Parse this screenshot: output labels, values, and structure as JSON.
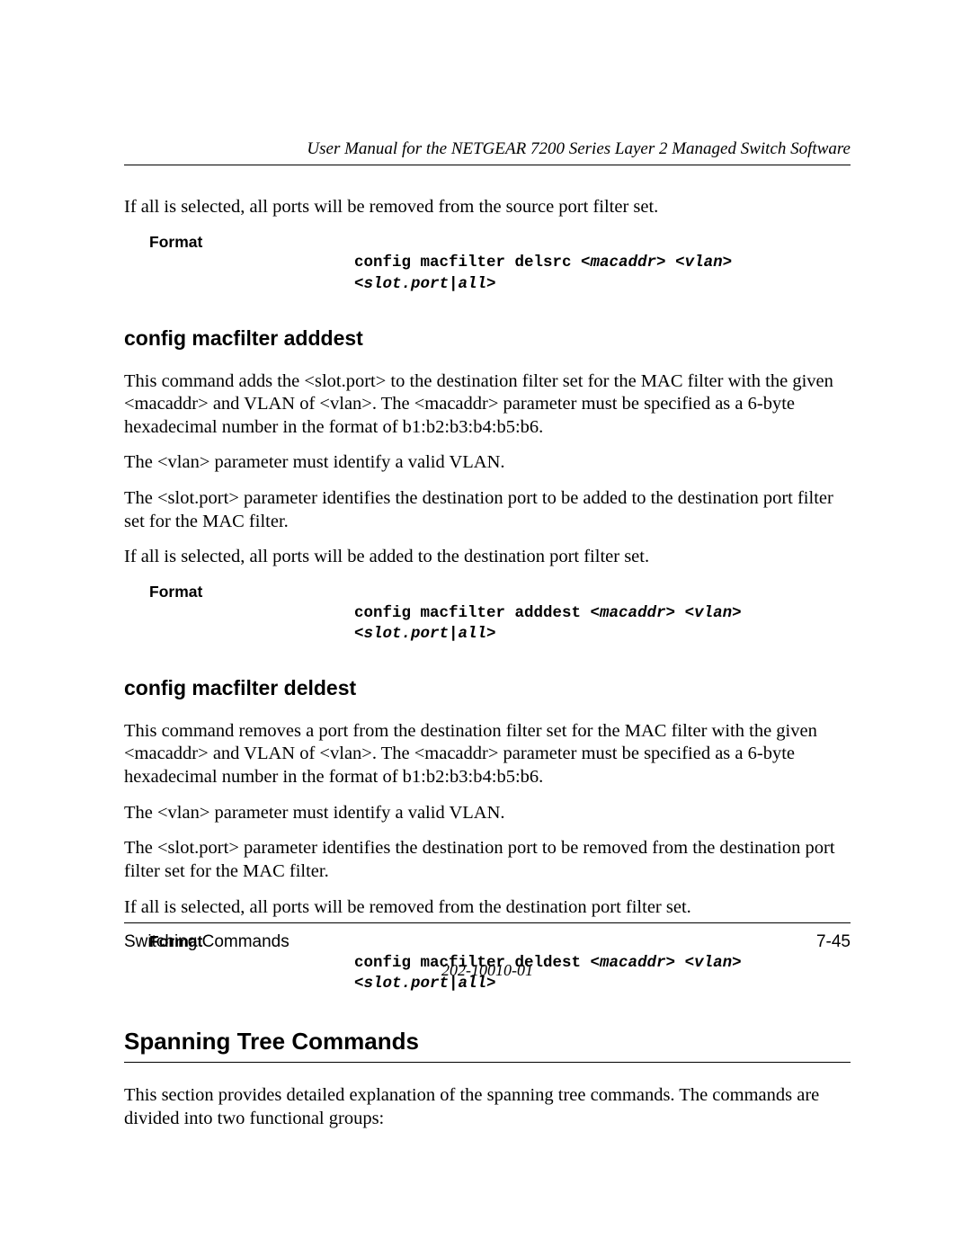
{
  "header": {
    "title": "User Manual for the NETGEAR 7200 Series Layer 2 Managed Switch Software"
  },
  "intro_p1": "If all is selected, all ports will be removed from the source port filter set.",
  "fmt1": {
    "label": "Format",
    "cmd_prefix": "config macfilter delsrc ",
    "arg1": "<macaddr>",
    "sep1": " ",
    "arg2": "<vlan>",
    "line2_arg": "<slot.port|all>"
  },
  "sec1": {
    "heading": "config macfilter adddest",
    "p1": "This command adds the <slot.port> to the destination filter set for the MAC filter with the given <macaddr> and VLAN of <vlan>.   The <macaddr> parameter must be specified as a 6-byte hexadecimal number in the format of b1:b2:b3:b4:b5:b6.",
    "p2": "The <vlan> parameter must identify a valid VLAN.",
    "p3": "The <slot.port> parameter identifies the destination port to be added to the destination port filter set for the MAC filter.",
    "p4": "If all is selected, all ports will be added to the destination port filter set.",
    "fmt": {
      "label": "Format",
      "cmd_prefix": "config macfilter adddest ",
      "arg1": "<macaddr>",
      "sep1": " ",
      "arg2": "<vlan>",
      "line2_arg": "<slot.port|all>"
    }
  },
  "sec2": {
    "heading": "config macfilter deldest",
    "p1": "This command removes a port from the destination filter set for the MAC filter with the given <macaddr> and VLAN of <vlan>. The <macaddr> parameter must be specified as a 6-byte hexadecimal number in the format of b1:b2:b3:b4:b5:b6.",
    "p2": "The <vlan> parameter must identify a valid VLAN.",
    "p3": "The <slot.port> parameter identifies the destination port to be removed from the destination port filter set for the MAC filter.",
    "p4": "If all is selected, all ports will be removed from the destination port filter set.",
    "fmt": {
      "label": "Format",
      "cmd_prefix": "config macfilter deldest ",
      "arg1": "<macaddr>",
      "sep1": " ",
      "arg2": "<vlan>",
      "line2_arg": "<slot.port|all>"
    }
  },
  "sec3": {
    "heading": "Spanning Tree Commands",
    "p1": "This section provides detailed explanation of the spanning tree commands. The commands are divided into two functional groups:"
  },
  "footer": {
    "left": "Switching Commands",
    "right": "7-45",
    "doc_code": "202-10010-01"
  }
}
